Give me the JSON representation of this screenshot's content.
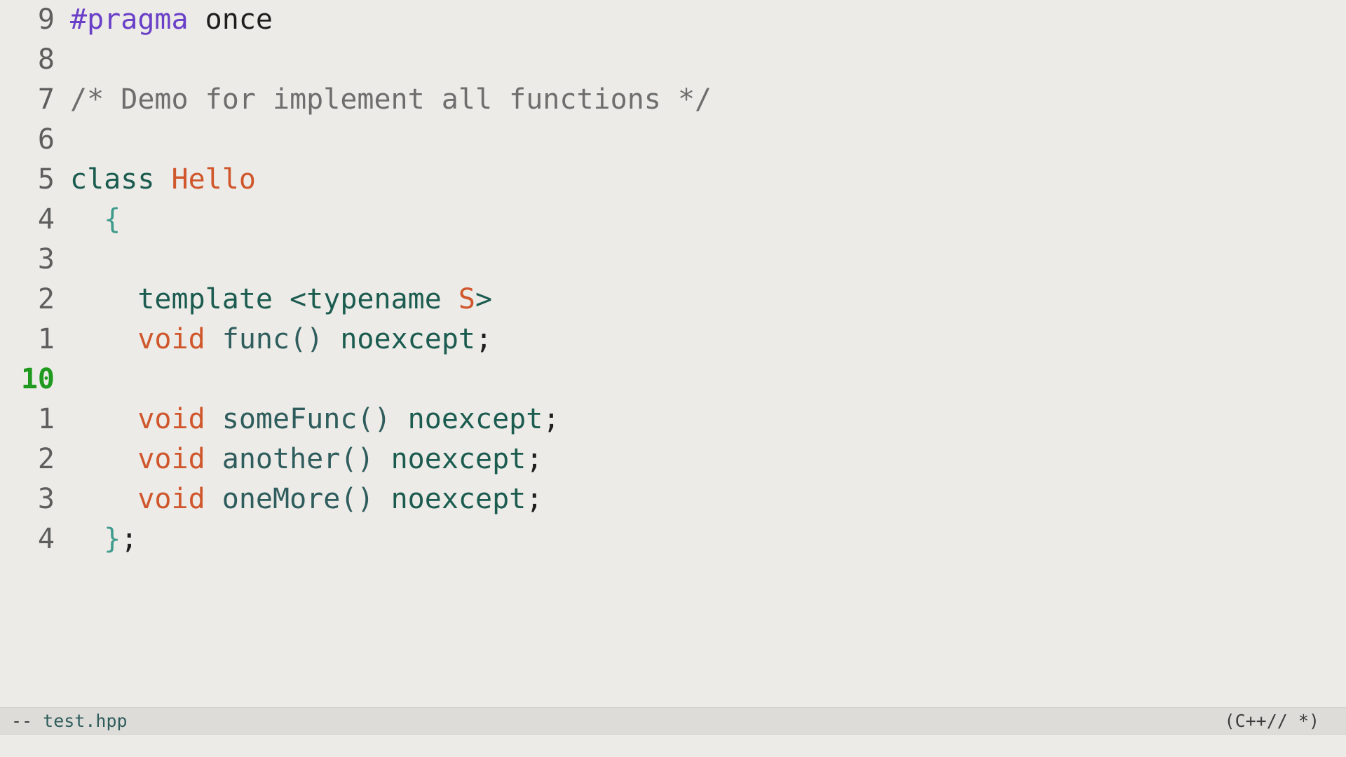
{
  "editor": {
    "lines": [
      {
        "num": "9",
        "current": false,
        "tokens": [
          {
            "t": "#pragma",
            "c": "preproc"
          },
          {
            "t": " once",
            "c": "plain"
          }
        ]
      },
      {
        "num": "8",
        "current": false,
        "tokens": []
      },
      {
        "num": "7",
        "current": false,
        "tokens": [
          {
            "t": "/* Demo for implement all functions */",
            "c": "comment"
          }
        ]
      },
      {
        "num": "6",
        "current": false,
        "tokens": []
      },
      {
        "num": "5",
        "current": false,
        "tokens": [
          {
            "t": "class ",
            "c": "kw"
          },
          {
            "t": "Hello",
            "c": "type"
          }
        ]
      },
      {
        "num": "4",
        "current": false,
        "tokens": [
          {
            "t": "  ",
            "c": "plain"
          },
          {
            "t": "{",
            "c": "brace"
          }
        ]
      },
      {
        "num": "3",
        "current": false,
        "tokens": []
      },
      {
        "num": "2",
        "current": false,
        "tokens": [
          {
            "t": "    template ",
            "c": "kw"
          },
          {
            "t": "<typename ",
            "c": "kw"
          },
          {
            "t": "S",
            "c": "type"
          },
          {
            "t": ">",
            "c": "kw"
          }
        ]
      },
      {
        "num": "1",
        "current": false,
        "tokens": [
          {
            "t": "    void ",
            "c": "type"
          },
          {
            "t": "func() ",
            "c": "fn"
          },
          {
            "t": "noexcept",
            "c": "kw"
          },
          {
            "t": ";",
            "c": "punct"
          }
        ]
      },
      {
        "num": "10",
        "current": true,
        "tokens": []
      },
      {
        "num": "1",
        "current": false,
        "tokens": [
          {
            "t": "    void ",
            "c": "type"
          },
          {
            "t": "someFunc() ",
            "c": "fn"
          },
          {
            "t": "noexcept",
            "c": "kw"
          },
          {
            "t": ";",
            "c": "punct"
          }
        ]
      },
      {
        "num": "2",
        "current": false,
        "tokens": [
          {
            "t": "    void ",
            "c": "type"
          },
          {
            "t": "another() ",
            "c": "fn"
          },
          {
            "t": "noexcept",
            "c": "kw"
          },
          {
            "t": ";",
            "c": "punct"
          }
        ]
      },
      {
        "num": "3",
        "current": false,
        "tokens": [
          {
            "t": "    void ",
            "c": "type"
          },
          {
            "t": "oneMore() ",
            "c": "fn"
          },
          {
            "t": "noexcept",
            "c": "kw"
          },
          {
            "t": ";",
            "c": "punct"
          }
        ]
      },
      {
        "num": "4",
        "current": false,
        "tokens": [
          {
            "t": "  ",
            "c": "plain"
          },
          {
            "t": "}",
            "c": "brace"
          },
          {
            "t": ";",
            "c": "punct"
          }
        ]
      }
    ]
  },
  "modeline": {
    "prefix": "-- ",
    "filename": "test.hpp",
    "mode": "(C++// *)"
  },
  "colors": {
    "background": "#ecebe7",
    "current_line_number": "#1f9a1f",
    "preproc": "#6a3fc8",
    "keyword": "#1c5c50",
    "type": "#d0562b",
    "function": "#2f5d5d",
    "comment": "#6e6e6e"
  }
}
